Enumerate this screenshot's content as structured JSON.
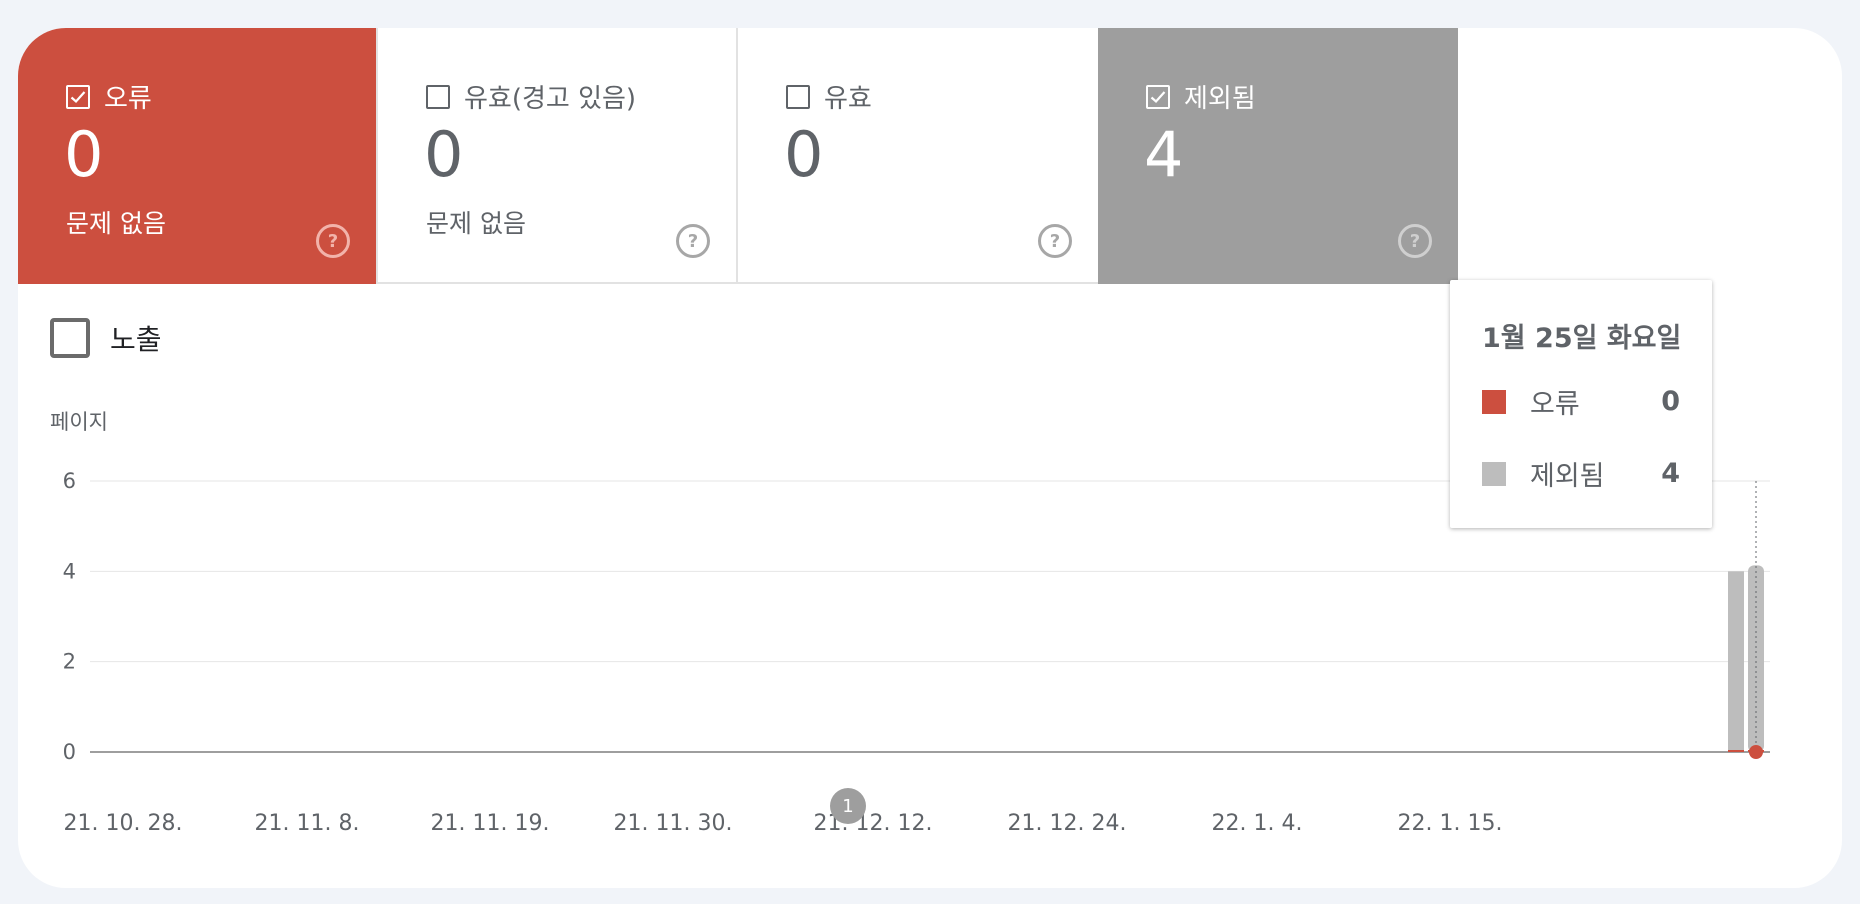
{
  "tiles": [
    {
      "label": "오류",
      "value": "0",
      "sub": "문제 없음",
      "checked": true,
      "color": "#cc4f3f"
    },
    {
      "label": "유효(경고 있음)",
      "value": "0",
      "sub": "문제 없음",
      "checked": false
    },
    {
      "label": "유효",
      "value": "0",
      "sub": "",
      "checked": false
    },
    {
      "label": "제외됨",
      "value": "4",
      "sub": "",
      "checked": true,
      "color": "#9e9e9e"
    }
  ],
  "impressions": {
    "label": "노출",
    "checked": false
  },
  "chart_data": {
    "type": "bar",
    "ylabel": "페이지",
    "ylim": [
      0,
      6
    ],
    "yticks": [
      "0",
      "2",
      "4",
      "6"
    ],
    "xtick_labels": [
      "21. 10. 28.",
      "21. 11. 8.",
      "21. 11. 19.",
      "21. 11. 30.",
      "21. 12. 12.",
      "21. 12. 24.",
      "22. 1. 4.",
      "22. 1. 15."
    ],
    "series": [
      {
        "name": "오류",
        "color": "#cc4f3f",
        "points": [
          {
            "x": "22. 1. 24.",
            "y": 0
          },
          {
            "x": "22. 1. 25.",
            "y": 0
          }
        ]
      },
      {
        "name": "제외됨",
        "color": "#bdbdbd",
        "points": [
          {
            "x": "22. 1. 24.",
            "y": 4
          },
          {
            "x": "22. 1. 25.",
            "y": 4
          }
        ]
      }
    ],
    "annotation": "1"
  },
  "tooltip": {
    "date": "1월 25일 화요일",
    "rows": [
      {
        "label": "오류",
        "value": "0",
        "color": "#cc4f3f"
      },
      {
        "label": "제외됨",
        "value": "4",
        "color": "#bdbdbd"
      }
    ]
  }
}
